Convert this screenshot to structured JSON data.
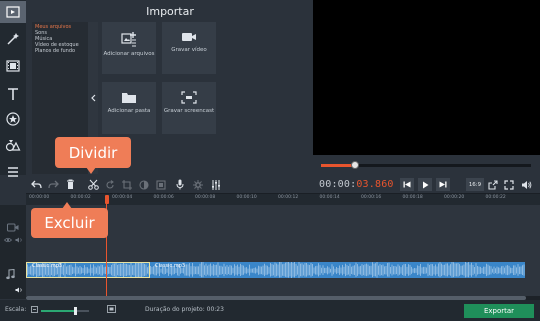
{
  "import": {
    "title": "Importar",
    "categories": [
      "Meus arquivos",
      "Sons",
      "Música",
      "Vídeo de estoque",
      "Planos de fundo"
    ],
    "tiles": [
      {
        "label": "Adicionar arquivos",
        "icon": "add-files-icon"
      },
      {
        "label": "Gravar vídeo",
        "icon": "camera-icon"
      },
      {
        "label": "Adicionar pasta",
        "icon": "folder-icon"
      },
      {
        "label": "Gravar screencast",
        "icon": "screencast-icon"
      }
    ]
  },
  "player": {
    "progress": 0.16,
    "timecode_prefix": "00:00:",
    "timecode_value": "03.860",
    "aspect": "16:9"
  },
  "ruler": {
    "ticks": [
      "00:00:00",
      "00:00:02",
      "00:00:04",
      "00:00:06",
      "00:00:08",
      "00:00:10",
      "00:00:12",
      "00:00:14",
      "00:00:16",
      "00:00:18",
      "00:00:20",
      "00:00:22"
    ]
  },
  "timeline": {
    "clip1_name": "Classic.mp3",
    "clip2_name": "Classic.mp3"
  },
  "bottom": {
    "scale_label": "Escala:",
    "zoom_level": 0.7,
    "duration_label": "Duração do projeto:  00:23",
    "export_label": "Exportar"
  },
  "callouts": {
    "split": "Dividir",
    "delete": "Excluir"
  },
  "colors": {
    "accent": "#e8552e",
    "callout": "#ef7d57",
    "audio_clip": "#3a86c9",
    "export": "#1f8f5a"
  }
}
